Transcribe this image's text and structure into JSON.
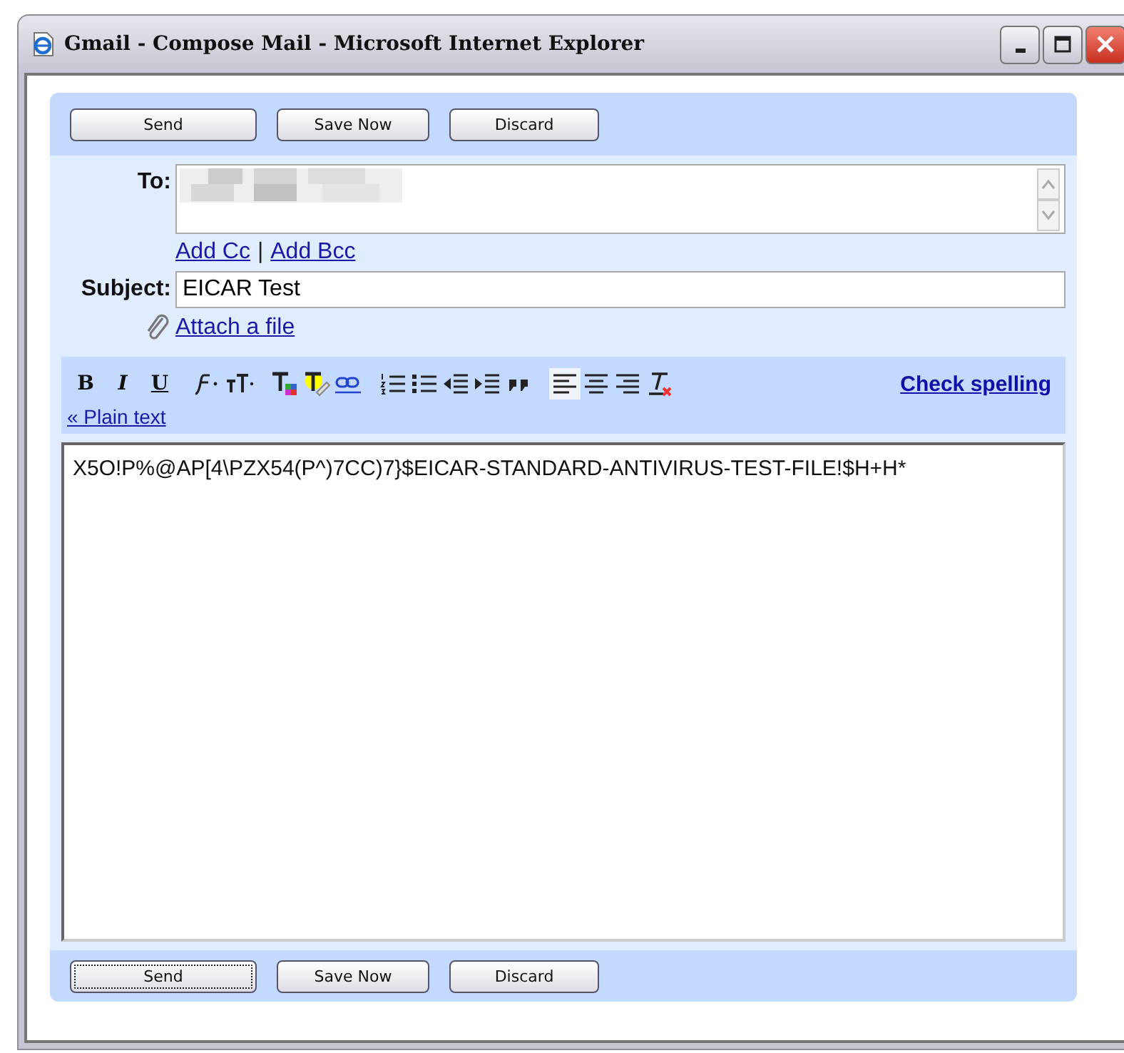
{
  "window": {
    "title": "Gmail - Compose Mail - Microsoft Internet Explorer"
  },
  "top_buttons": [
    {
      "label": "Send",
      "focused": false
    },
    {
      "label": "Save Now",
      "focused": false
    },
    {
      "label": "Discard",
      "focused": false
    }
  ],
  "to": {
    "label": "To:"
  },
  "cc_links": [
    {
      "label": "Add Cc"
    },
    {
      "label": "Add Bcc"
    }
  ],
  "cc_separator": "|",
  "subject": {
    "label": "Subject:",
    "value": "EICAR Test"
  },
  "attach": {
    "label": "Attach a file"
  },
  "toolbar": [
    {
      "kind": "bold",
      "label": "B",
      "selected": false
    },
    {
      "kind": "italic",
      "label": "I",
      "selected": false
    },
    {
      "kind": "underline",
      "label": "U",
      "selected": false
    },
    {
      "kind": "font",
      "selected": false
    },
    {
      "kind": "size",
      "selected": false
    },
    {
      "kind": "textcolor",
      "selected": false
    },
    {
      "kind": "highlight",
      "selected": false
    },
    {
      "kind": "link",
      "selected": false
    },
    {
      "kind": "numbered",
      "selected": false
    },
    {
      "kind": "bulleted",
      "selected": false
    },
    {
      "kind": "outdent",
      "selected": false
    },
    {
      "kind": "indent",
      "selected": false
    },
    {
      "kind": "quote",
      "selected": false
    },
    {
      "kind": "alignleft",
      "selected": true
    },
    {
      "kind": "aligncenter",
      "selected": false
    },
    {
      "kind": "alignright",
      "selected": false
    },
    {
      "kind": "clear",
      "selected": false
    }
  ],
  "check_spelling": "Check spelling",
  "plain_text": "« Plain text",
  "body": "X5O!P%@AP[4\\PZX54(P^)7CC)7}$EICAR-STANDARD-ANTIVIRUS-TEST-FILE!$H+H*",
  "bottom_buttons": [
    {
      "label": "Send",
      "focused": true
    },
    {
      "label": "Save Now",
      "focused": false
    },
    {
      "label": "Discard",
      "focused": false
    }
  ]
}
